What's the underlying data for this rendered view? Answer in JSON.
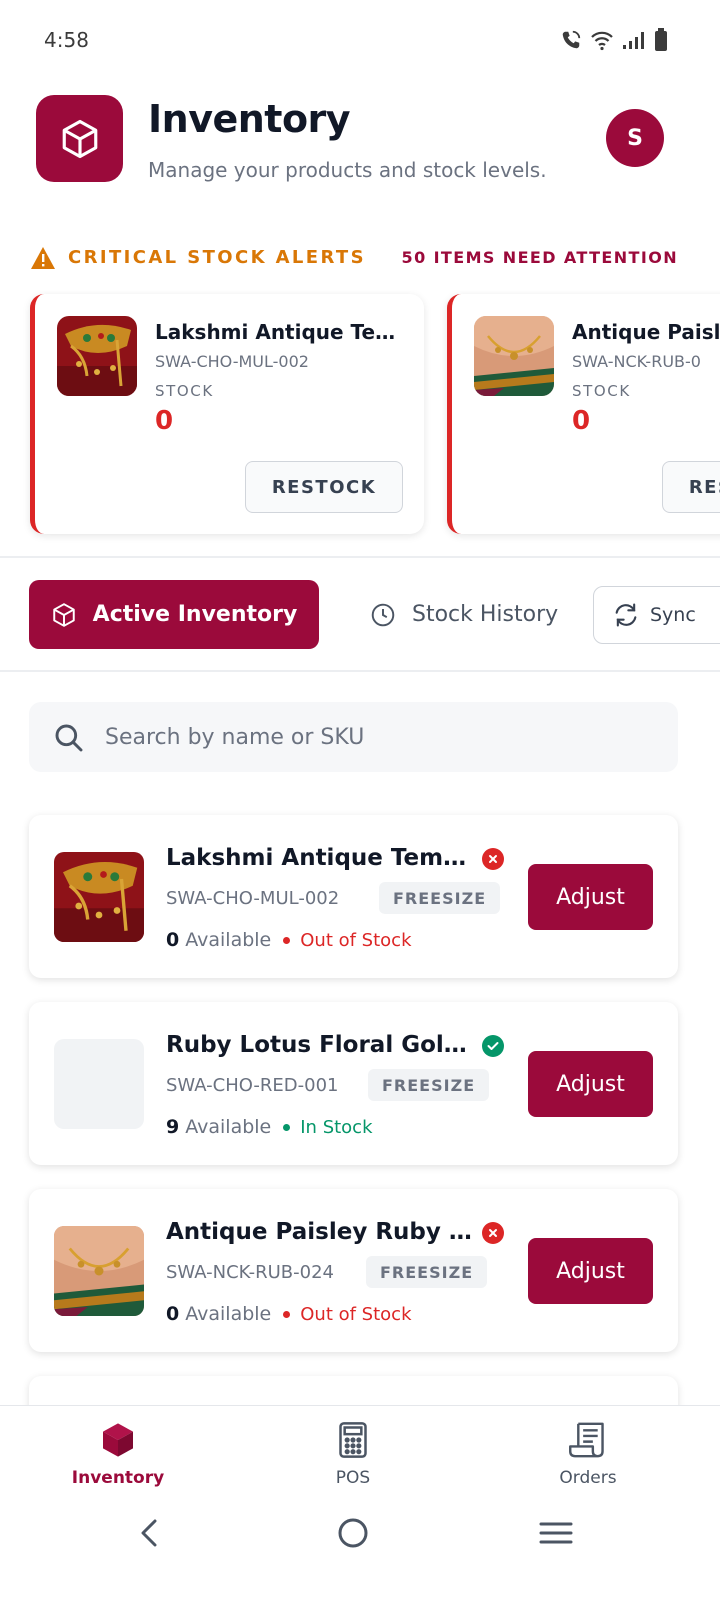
{
  "status_bar": {
    "time": "4:58"
  },
  "header": {
    "title": "Inventory",
    "subtitle": "Manage your products and stock levels.",
    "avatar_initial": "S"
  },
  "alerts": {
    "title": "CRITICAL STOCK ALERTS",
    "count_text": "50 ITEMS NEED ATTENTION",
    "stock_label": "STOCK",
    "restock_label": "RESTOCK",
    "items": [
      {
        "name": "Lakshmi Antique Tem...",
        "sku": "SWA-CHO-MUL-002",
        "stock": "0"
      },
      {
        "name": "Antique Paisl",
        "sku": "SWA-NCK-RUB-0",
        "stock": "0"
      }
    ]
  },
  "tabs": {
    "active_label": "Active Inventory",
    "history_label": "Stock History",
    "sync_label": "Sync"
  },
  "search": {
    "placeholder": "Search by name or SKU"
  },
  "products": [
    {
      "name": "Lakshmi Antique Templ...",
      "sku": "SWA-CHO-MUL-002",
      "size": "FREESIZE",
      "available_count": "0",
      "available_label": "Available",
      "status": "Out of Stock",
      "status_color": "#dc2626",
      "adjust_label": "Adjust"
    },
    {
      "name": "Ruby Lotus Floral Gold ...",
      "sku": "SWA-CHO-RED-001",
      "size": "FREESIZE",
      "available_count": "9",
      "available_label": "Available",
      "status": "In Stock",
      "status_color": "#059669",
      "adjust_label": "Adjust"
    },
    {
      "name": "Antique Paisley Ruby S...",
      "sku": "SWA-NCK-RUB-024",
      "size": "FREESIZE",
      "available_count": "0",
      "available_label": "Available",
      "status": "Out of Stock",
      "status_color": "#dc2626",
      "adjust_label": "Adjust"
    }
  ],
  "bottom_nav": [
    {
      "label": "Inventory",
      "icon": "box-icon",
      "active": true
    },
    {
      "label": "POS",
      "icon": "calculator-icon",
      "active": false
    },
    {
      "label": "Orders",
      "icon": "receipt-icon",
      "active": false
    }
  ],
  "colors": {
    "brand": "#9b0a3b",
    "alert_orange": "#d97706",
    "out_of_stock": "#dc2626",
    "in_stock": "#059669"
  }
}
